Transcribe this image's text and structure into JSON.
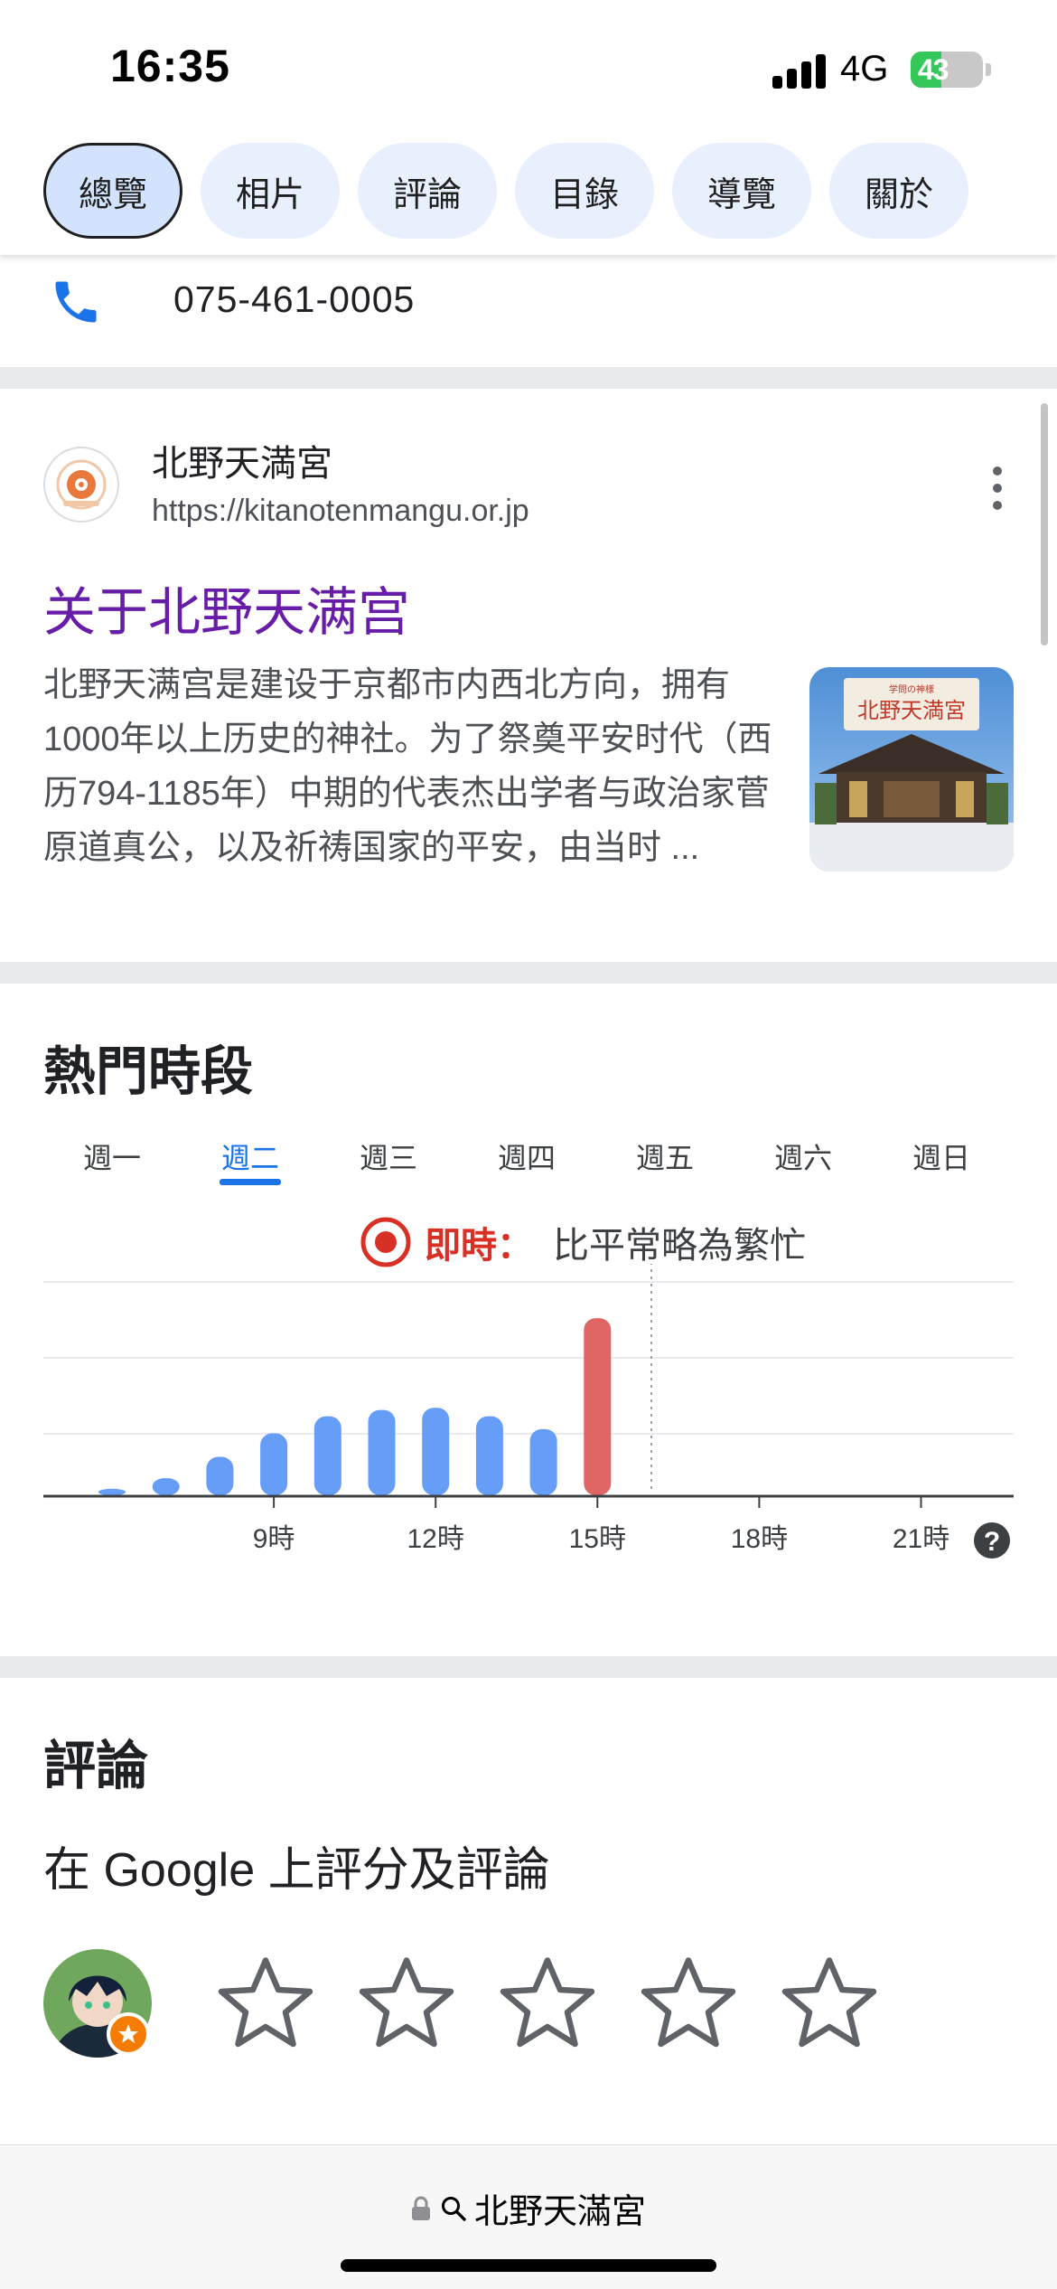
{
  "status_bar": {
    "time": "16:35",
    "network": "4G",
    "battery_level": "43",
    "battery_fraction": 0.43
  },
  "tabs": [
    {
      "label": "總覽",
      "active": true
    },
    {
      "label": "相片"
    },
    {
      "label": "評論"
    },
    {
      "label": "目錄"
    },
    {
      "label": "導覽"
    },
    {
      "label": "關於"
    }
  ],
  "phone": {
    "number": "075-461-0005"
  },
  "result": {
    "site_name": "北野天満宮",
    "url": "https://kitanotenmangu.or.jp",
    "title": "关于北野天满宫",
    "snippet": "北野天满宫是建设于京都市内西北方向，拥有1000年以上历史的神社。为了祭奠平安时代（西历794-1185年）中期的代表杰出学者与政治家菅原道真公，以及祈祷国家的平安，由当时 ...",
    "thumbnail_caption": "北野天満宮"
  },
  "popular_times": {
    "title": "熱門時段",
    "days": [
      "週一",
      "週二",
      "週三",
      "週四",
      "週五",
      "週六",
      "週日"
    ],
    "selected_day": "週二",
    "live_label": "即時：",
    "live_text": "比平常略為繁忙"
  },
  "chart_data": {
    "type": "bar",
    "title": "熱門時段",
    "x": [
      6,
      7,
      8,
      9,
      10,
      11,
      12,
      13,
      14,
      15,
      16,
      17,
      18,
      19,
      20,
      21,
      22,
      23
    ],
    "x_tick_labels": [
      "9時",
      "12時",
      "15時",
      "18時",
      "21時"
    ],
    "x_ticks": [
      9,
      12,
      15,
      18,
      21
    ],
    "series": [
      {
        "values": [
          3,
          8,
          18,
          29,
          37,
          40,
          41,
          37,
          31,
          0,
          0,
          0,
          0,
          0,
          0,
          0,
          0,
          0
        ]
      },
      {
        "values": [
          0,
          0,
          0,
          0,
          0,
          0,
          0,
          0,
          0,
          83,
          0,
          0,
          0,
          0,
          0,
          0,
          0,
          0
        ]
      }
    ],
    "live_hour": 16,
    "ylim": [
      0,
      100
    ],
    "grid": true,
    "colors": {
      "usual": "#669df6",
      "live": "#e06666",
      "axis": "#3c4043",
      "grid": "#e8eaed"
    },
    "help_label": "?"
  },
  "reviews": {
    "title": "評論",
    "subtitle": "在 Google 上評分及評論",
    "stars": [
      1,
      2,
      3,
      4,
      5
    ]
  },
  "bottom_bar": {
    "address": "北野天滿宮"
  },
  "colors": {
    "accent": "#1a73e8",
    "visited_link": "#681da8",
    "live_red": "#d93025",
    "tab_bg": "#e8f0fe"
  }
}
